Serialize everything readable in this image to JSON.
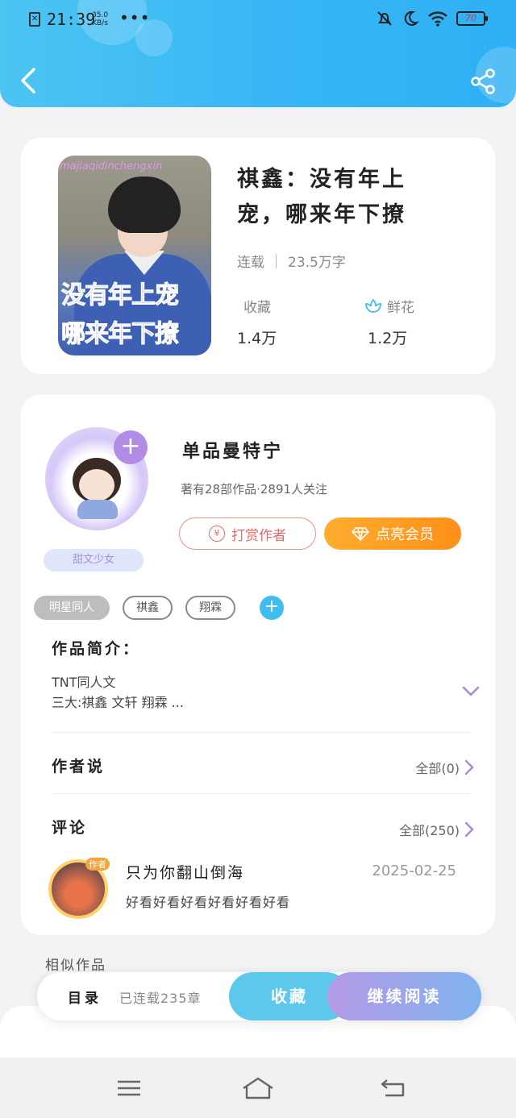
{
  "status_bar": {
    "time": "21:39",
    "net_speed": "35.0",
    "net_unit": "KB/s",
    "more": "•••",
    "battery": "70"
  },
  "header": {
    "back_icon": "chevron-left-icon",
    "share_icon": "share-icon"
  },
  "book": {
    "title": "祺鑫：没有年上宠，哪来年下撩",
    "cover_watermark": "majiaqidinchengxin",
    "cover_text_line1": "没有年上宠",
    "cover_text_line2": "哪来年下撩",
    "status": "连载",
    "word_count": "23.5万字",
    "collect_label": "收藏",
    "collect_value": "1.4万",
    "flower_label": "鲜花",
    "flower_value": "1.2万"
  },
  "author": {
    "name": "单品曼特宁",
    "stats": "著有28部作品·2891人关注",
    "avatar_tag": "甜文少女",
    "reward_label": "打赏作者",
    "vip_label": "点亮会员"
  },
  "tags": [
    "明星同人",
    "祺鑫",
    "翔霖"
  ],
  "intro": {
    "label": "作品简介：",
    "line1": "TNT同人文",
    "line2": "三大:祺鑫 文轩 翔霖 ..."
  },
  "author_says": {
    "label": "作者说",
    "more": "全部(0)"
  },
  "comments": {
    "label": "评论",
    "more": "全部(250)",
    "first": {
      "badge": "作者",
      "name": "只为你翻山倒海",
      "date": "2025-02-25",
      "text": "好看好看好看好看好看好看"
    }
  },
  "similar_label": "相似作品",
  "action_bar": {
    "directory": "目录",
    "chapters": "已连载235章",
    "favorite": "收藏",
    "continue": "继续阅读"
  },
  "colors": {
    "header": "#39b7f5",
    "accent_orange": "#ff9a1f",
    "accent_purple": "#b38be6",
    "accent_blue": "#5cc9ec"
  }
}
